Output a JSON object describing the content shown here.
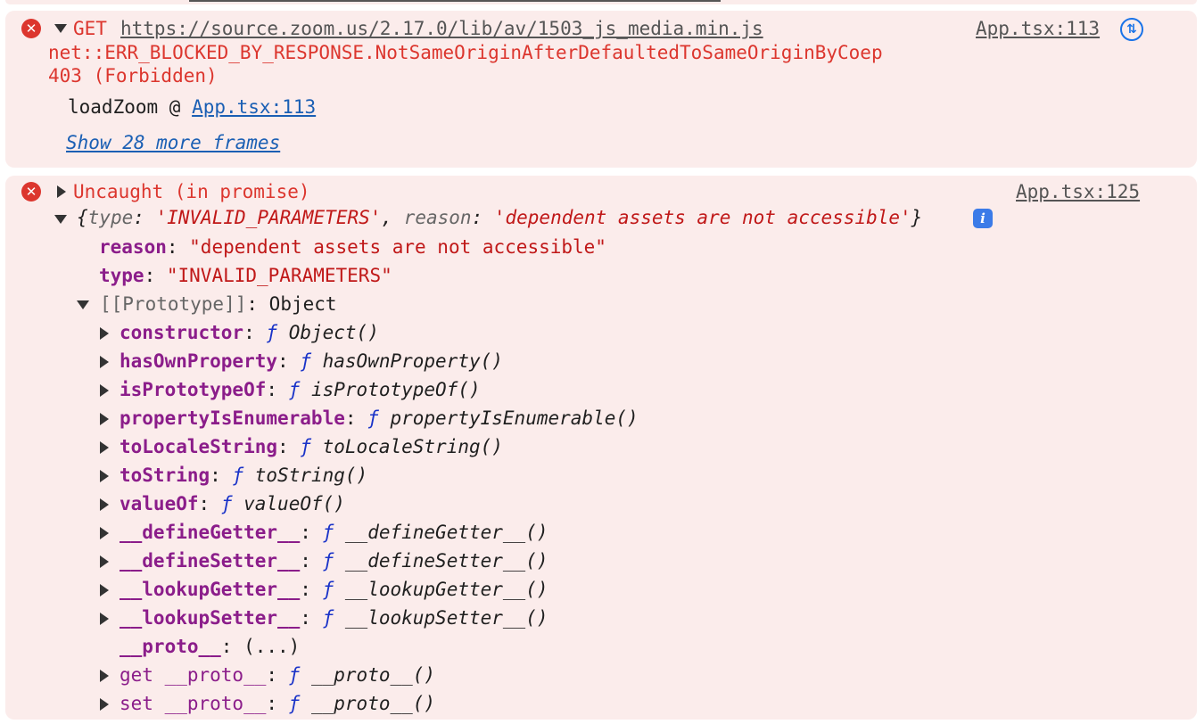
{
  "msg1": {
    "method": "GET",
    "url": "https://source.zoom.us/2.17.0/lib/av/1503_js_media.min.js",
    "error_line1": "net::ERR_BLOCKED_BY_RESPONSE.NotSameOriginAfterDefaultedToSameOriginByCoep",
    "error_line2": "403 (Forbidden)",
    "source": "App.tsx:113",
    "stack_fn": "loadZoom @ ",
    "stack_link": "App.tsx:113",
    "show_more": "Show 28 more frames"
  },
  "msg2": {
    "title": "Uncaught (in promise)",
    "source": "App.tsx:125",
    "summary": {
      "open": "{",
      "k1": "type",
      "v1": "'INVALID_PARAMETERS'",
      "comma": ", ",
      "k2": "reason",
      "v2": "'dependent assets are not accessible'",
      "close": "}"
    },
    "props": [
      {
        "key": "reason",
        "value": "\"dependent assets are not accessible\""
      },
      {
        "key": "type",
        "value": "\"INVALID_PARAMETERS\""
      }
    ],
    "prototype_label": "[[Prototype]]",
    "prototype_value": "Object",
    "proto_members": [
      {
        "key": "constructor",
        "fn": "Object()"
      },
      {
        "key": "hasOwnProperty",
        "fn": "hasOwnProperty()"
      },
      {
        "key": "isPrototypeOf",
        "fn": "isPrototypeOf()"
      },
      {
        "key": "propertyIsEnumerable",
        "fn": "propertyIsEnumerable()"
      },
      {
        "key": "toLocaleString",
        "fn": "toLocaleString()"
      },
      {
        "key": "toString",
        "fn": "toString()"
      },
      {
        "key": "valueOf",
        "fn": "valueOf()"
      },
      {
        "key": "__defineGetter__",
        "fn": "__defineGetter__()"
      },
      {
        "key": "__defineSetter__",
        "fn": "__defineSetter__()"
      },
      {
        "key": "__lookupGetter__",
        "fn": "__lookupGetter__()"
      },
      {
        "key": "__lookupSetter__",
        "fn": "__lookupSetter__()"
      }
    ],
    "proto_key": "__proto__",
    "proto_val": "(...)",
    "getter_label": "get __proto__",
    "getter_fn": "__proto__()",
    "setter_label": "set __proto__",
    "setter_fn": "__proto__()"
  },
  "common": {
    "colon": ": ",
    "f": "ƒ",
    "at": "@",
    "error_icon": "close-icon",
    "info_icon": "info-icon",
    "network_icon": "network-request-icon"
  }
}
